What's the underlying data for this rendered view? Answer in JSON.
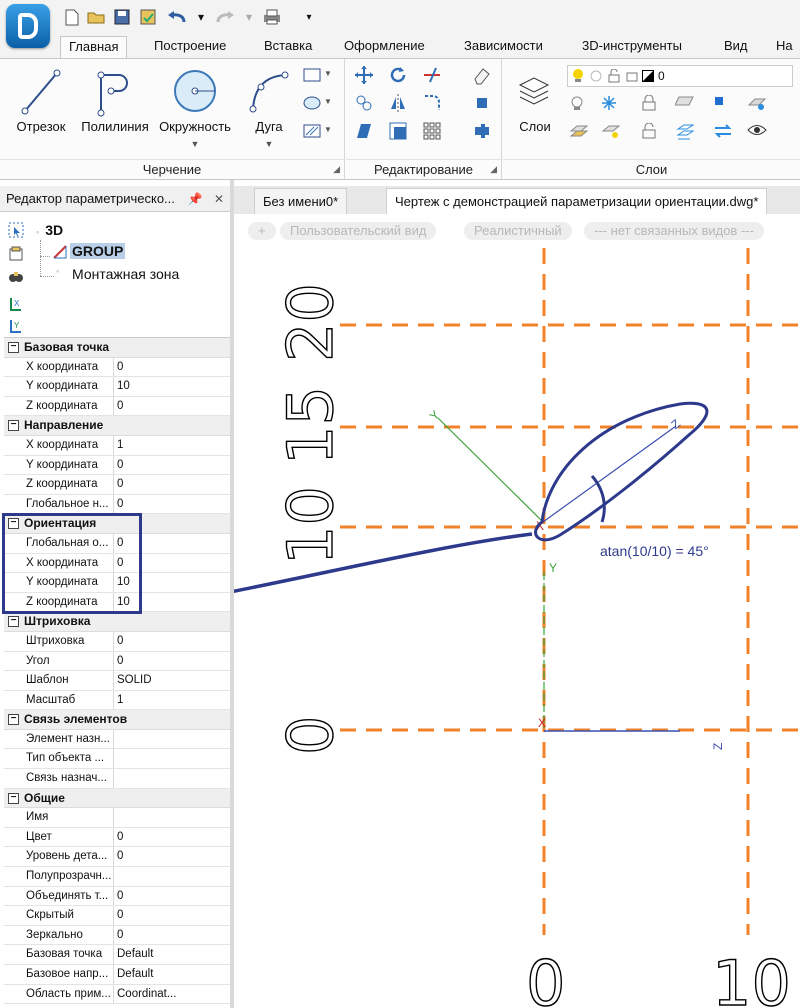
{
  "ribbon": {
    "tabs": [
      "Главная",
      "Построение",
      "Вставка",
      "Оформление",
      "Зависимости",
      "3D-инструменты",
      "Вид",
      "На"
    ],
    "groups": {
      "drawing": {
        "label": "Черчение",
        "tools": [
          "Отрезок",
          "Полилиния",
          "Окружность",
          "Дуга"
        ]
      },
      "editing": {
        "label": "Редактирование"
      },
      "layers": {
        "label": "Слои",
        "button": "Слои",
        "current_layer": "0"
      }
    }
  },
  "left_panel": {
    "title": "Редактор параметрическо...",
    "tree": {
      "root": "3D",
      "group": "GROUP",
      "zone": "Монтажная зона"
    },
    "sections": [
      {
        "title": "Базовая точка",
        "rows": [
          [
            "X координата",
            "0"
          ],
          [
            "Y координата",
            "10"
          ],
          [
            "Z координата",
            "0"
          ]
        ]
      },
      {
        "title": "Направление",
        "rows": [
          [
            "X координата",
            "1"
          ],
          [
            "Y координата",
            "0"
          ],
          [
            "Z координата",
            "0"
          ],
          [
            "Глобальное н...",
            "0"
          ]
        ]
      },
      {
        "title": "Ориентация",
        "rows": [
          [
            "Глобальная о...",
            "0"
          ],
          [
            "X координата",
            "0"
          ],
          [
            "Y координата",
            "10"
          ],
          [
            "Z координата",
            "10"
          ]
        ]
      },
      {
        "title": "Штриховка",
        "rows": [
          [
            "Штриховка",
            "0"
          ],
          [
            "Угол",
            "0"
          ],
          [
            "Шаблон",
            "SOLID"
          ],
          [
            "Масштаб",
            "1"
          ]
        ]
      },
      {
        "title": "Связь элементов",
        "rows": [
          [
            "Элемент назн...",
            ""
          ],
          [
            "Тип объекта ...",
            ""
          ],
          [
            "Связь назнач...",
            ""
          ]
        ]
      },
      {
        "title": "Общие",
        "rows": [
          [
            "Имя",
            ""
          ],
          [
            "Цвет",
            "0"
          ],
          [
            "Уровень дета...",
            "0"
          ],
          [
            "Полупрозрачн...",
            ""
          ],
          [
            "Объединять т...",
            "0"
          ],
          [
            "Скрытый",
            "0"
          ],
          [
            "Зеркально",
            "0"
          ],
          [
            "Базовая точка",
            "Default"
          ],
          [
            "Базовое напр...",
            "Default"
          ],
          [
            "Область прим...",
            "Coordinat..."
          ]
        ]
      }
    ]
  },
  "document": {
    "tabs": [
      "Без имени0*",
      "Чертеж с демонстрацией параметризации ориентации.dwg*"
    ],
    "view_pills": [
      "+",
      "Пользовательский вид",
      "Реалистичный",
      "--- нет связанных видов ---"
    ]
  },
  "canvas": {
    "grid_color": "#f0822a",
    "y_labels": [
      "0",
      "10",
      "15",
      "20"
    ],
    "x_labels": [
      "0",
      "10"
    ],
    "annotation": "atan(10/10) = 45°",
    "axis_y_label": "Y",
    "axis_z_label": "Z",
    "axis_x_label": "X",
    "annotation_color": "#2d3a8c"
  }
}
